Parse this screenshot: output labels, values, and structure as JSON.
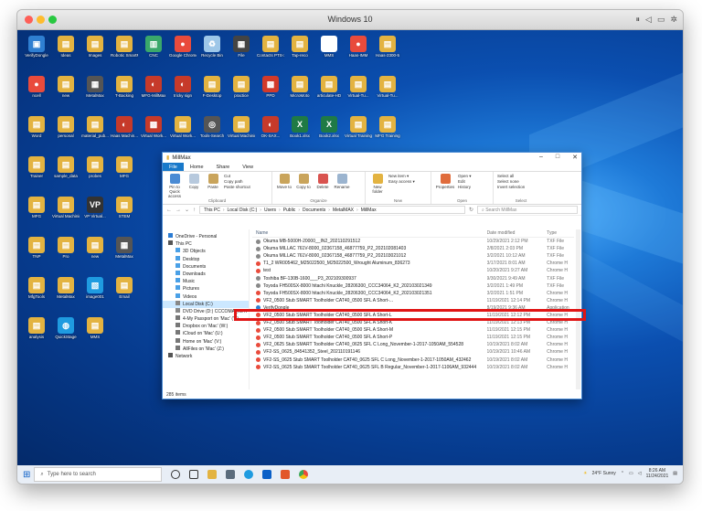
{
  "mac_window": {
    "title": "Windows 10"
  },
  "desktop_icons": [
    {
      "label": "VerifyDongle",
      "color": "#2f7fd1",
      "glyph": "▣"
    },
    {
      "label": "Ideas",
      "color": "#e3b341",
      "glyph": "▤"
    },
    {
      "label": "Images",
      "color": "#e3b341",
      "glyph": "▤"
    },
    {
      "label": "Robotic SmartMachi...",
      "color": "#e3b341",
      "glyph": "▤"
    },
    {
      "label": "CNC",
      "color": "#3aa86b",
      "glyph": "▥"
    },
    {
      "label": "Google Chrome",
      "color": "#e94b3c",
      "glyph": "●"
    },
    {
      "label": "Recycle Bin",
      "color": "#9ec7e8",
      "glyph": "♻"
    },
    {
      "label": "File",
      "color": "#444",
      "glyph": "▦"
    },
    {
      "label": "Contacts PTS-2...",
      "color": "#e3b341",
      "glyph": "▤"
    },
    {
      "label": "Tap-reco",
      "color": "#e3b341",
      "glyph": "▤"
    },
    {
      "label": "MMS",
      "color": "#fff",
      "glyph": "▢"
    },
    {
      "label": "Haas-IMM",
      "color": "#e94b3c",
      "glyph": "●"
    },
    {
      "label": "Haas-2300-5",
      "color": "#e3b341",
      "glyph": "▤"
    },
    {
      "label": "ncell",
      "color": "#e94b3c",
      "glyph": "●"
    },
    {
      "label": "new",
      "color": "#e3b341",
      "glyph": "▤"
    },
    {
      "label": "MetalMax",
      "color": "#555",
      "glyph": "▦"
    },
    {
      "label": "T-Backing",
      "color": "#e3b341",
      "glyph": "▤"
    },
    {
      "label": "MFG-MillMax",
      "color": "#c63a2a",
      "glyph": "◐"
    },
    {
      "label": "tricky sign",
      "color": "#c63a2a",
      "glyph": "◐"
    },
    {
      "label": "F-Desktop",
      "color": "#e3b341",
      "glyph": "▤"
    },
    {
      "label": "practice",
      "color": "#e3b341",
      "glyph": "▤"
    },
    {
      "label": "PPD",
      "color": "#d23a2a",
      "glyph": "▩"
    },
    {
      "label": "MicroMoto",
      "color": "#e3b341",
      "glyph": "▤"
    },
    {
      "label": "articulate-HD",
      "color": "#e3b341",
      "glyph": "▤"
    },
    {
      "label": "Virtual-Tu...",
      "color": "#e3b341",
      "glyph": "▤"
    },
    {
      "label": "Virtual-Tu...",
      "color": "#e3b341",
      "glyph": "▤"
    },
    {
      "label": "Word",
      "color": "#e3b341",
      "glyph": "▤"
    },
    {
      "label": "personal",
      "color": "#e3b341",
      "glyph": "▤"
    },
    {
      "label": "material_pub...",
      "color": "#e3b341",
      "glyph": "▤"
    },
    {
      "label": "Haas Machin...",
      "color": "#c63a2a",
      "glyph": "◐"
    },
    {
      "label": "Virtual Work...",
      "color": "#c63a2a",
      "glyph": "▩"
    },
    {
      "label": "Virtual Work...",
      "color": "#e3b341",
      "glyph": "▤"
    },
    {
      "label": "Tools-Search",
      "color": "#555",
      "glyph": "◎"
    },
    {
      "label": "Virtual Machining",
      "color": "#e3b341",
      "glyph": "▤"
    },
    {
      "label": "OK-SAX...",
      "color": "#c63a2a",
      "glyph": "◐"
    },
    {
      "label": "Book1.xlsx",
      "color": "#1f7a45",
      "glyph": "X"
    },
    {
      "label": "Book2.xlsx",
      "color": "#1f7a45",
      "glyph": "X"
    },
    {
      "label": "Virtual Training",
      "color": "#e3b341",
      "glyph": "▤"
    },
    {
      "label": "MFG Training",
      "color": "#e3b341",
      "glyph": "▤"
    },
    {
      "label": "Trainer",
      "color": "#e3b341",
      "glyph": "▤"
    },
    {
      "label": "sample_data",
      "color": "#e3b341",
      "glyph": "▤"
    },
    {
      "label": "probes",
      "color": "#e3b341",
      "glyph": "▤"
    },
    {
      "label": "MFG",
      "color": "#e3b341",
      "glyph": "▤"
    },
    {
      "label": "MFG",
      "color": "#e3b341",
      "glyph": "▤"
    },
    {
      "label": "Virtual Machining",
      "color": "#e3b341",
      "glyph": "▤"
    },
    {
      "label": "VP Virtual...",
      "color": "#333",
      "glyph": "VP"
    },
    {
      "label": "STEM",
      "color": "#e3b341",
      "glyph": "▤"
    },
    {
      "label": "TNP",
      "color": "#e3b341",
      "glyph": "▤"
    },
    {
      "label": "Pro",
      "color": "#e3b341",
      "glyph": "▤"
    },
    {
      "label": "new",
      "color": "#e3b341",
      "glyph": "▤"
    },
    {
      "label": "MetalMax",
      "color": "#555",
      "glyph": "▦"
    },
    {
      "label": "MfgTools",
      "color": "#e3b341",
      "glyph": "▤"
    },
    {
      "label": "MetalMax",
      "color": "#e3b341",
      "glyph": "▤"
    },
    {
      "label": "image001",
      "color": "#1f9be0",
      "glyph": "▧"
    },
    {
      "label": "Email",
      "color": "#e3b341",
      "glyph": "▤"
    },
    {
      "label": "analysis",
      "color": "#e3b341",
      "glyph": "▤"
    },
    {
      "label": "QuickStage",
      "color": "#1f9be0",
      "glyph": "◍"
    },
    {
      "label": "MMS",
      "color": "#e3b341",
      "glyph": "▤"
    }
  ],
  "explorer": {
    "title": "MillMax",
    "ribbon_tabs": [
      "File",
      "Home",
      "Share",
      "View"
    ],
    "ribbon": {
      "clipboard": {
        "pin": "Pin to Quick access",
        "copy": "Copy",
        "paste": "Paste",
        "cut": "Cut",
        "copy_path": "Copy path",
        "paste_shortcut": "Paste shortcut",
        "label": "Clipboard"
      },
      "organize": {
        "move": "Move to",
        "copy": "Copy to",
        "delete": "Delete",
        "rename": "Rename",
        "label": "Organize"
      },
      "new": {
        "folder": "New folder",
        "new_item": "New item ▾",
        "easy_access": "Easy access ▾",
        "label": "New"
      },
      "open": {
        "properties": "Properties",
        "open": "Open ▾",
        "edit": "Edit",
        "history": "History",
        "label": "Open"
      },
      "select": {
        "all": "Select all",
        "none": "Select none",
        "invert": "Invert selection",
        "label": "Select"
      }
    },
    "address": {
      "path": [
        "This PC",
        "Local Disk (C:)",
        "Users",
        "Public",
        "Documents",
        "MetalMAX",
        "MillMax"
      ],
      "search_placeholder": "Search MillMax"
    },
    "nav": [
      {
        "label": "OneDrive - Personal",
        "top": true,
        "color": "#2b7cd3"
      },
      {
        "label": "This PC",
        "top": true,
        "color": "#555"
      },
      {
        "label": "3D Objects",
        "color": "#4aa0e6"
      },
      {
        "label": "Desktop",
        "color": "#4aa0e6"
      },
      {
        "label": "Documents",
        "color": "#4aa0e6"
      },
      {
        "label": "Downloads",
        "color": "#4aa0e6"
      },
      {
        "label": "Music",
        "color": "#4aa0e6"
      },
      {
        "label": "Pictures",
        "color": "#4aa0e6"
      },
      {
        "label": "Videos",
        "color": "#4aa0e6"
      },
      {
        "label": "Local Disk (C:)",
        "color": "#888",
        "selected": true
      },
      {
        "label": "DVD Drive (D:) CCCOMA_X64FR",
        "color": "#888"
      },
      {
        "label": "4-My Passport on 'Mac' (Y:)",
        "color": "#777"
      },
      {
        "label": "Dropbox on 'Mac' (W:)",
        "color": "#777"
      },
      {
        "label": "iCloud on 'Mac' (U:)",
        "color": "#777"
      },
      {
        "label": "Home on 'Mac' (V:)",
        "color": "#777"
      },
      {
        "label": "AllFiles on 'Mac' (Z:)",
        "color": "#777"
      },
      {
        "label": "Network",
        "top": true,
        "color": "#555"
      }
    ],
    "columns": {
      "name": "Name",
      "date": "Date modified",
      "type": "Type"
    },
    "files": [
      {
        "name": "Okuma MB-5000H-20000__IN2_202110291512",
        "date": "10/29/2021 2:12 PM",
        "type": "TXF File",
        "color": "#888"
      },
      {
        "name": "Okuma MILLAC 761V-8000_02367158_46877759_P2_202102081403",
        "date": "2/8/2021 2:03 PM",
        "type": "TXF File",
        "color": "#888"
      },
      {
        "name": "Okuma MILLAC 761V-8000_02367158_46877759_P2_202103021012",
        "date": "3/2/2021 10:12 AM",
        "type": "TXF File",
        "color": "#888"
      },
      {
        "name": "T1_2 WR005462_M25022500_M25022500_Wrought Aluminum_836273",
        "date": "3/17/2021 8:01 AM",
        "type": "Chrome H",
        "color": "#e94b3c"
      },
      {
        "name": "test",
        "date": "10/20/2021 9:27 AM",
        "type": "Chrome H",
        "color": "#e94b3c"
      },
      {
        "name": "Toshiba BF-130B-1600___P3_202109300937",
        "date": "9/30/2021 9:49 AM",
        "type": "TXF File",
        "color": "#888"
      },
      {
        "name": "Toyoda FH500SX-8000 hitachi Knuckle_28206300_CCC34064_K2_202103021349",
        "date": "3/2/2021 1:49 PM",
        "type": "TXF File",
        "color": "#888"
      },
      {
        "name": "Toyoda FH500SX-8000 hitachi Knuckle_28206300_CCC34064_K2_202103021351",
        "date": "3/2/2021 1:51 PM",
        "type": "Chrome H",
        "color": "#e94b3c"
      },
      {
        "name": "VF2_0500 Stub SMART Toolholder CAT40_0500 SFL A Short-...",
        "date": "11/19/2021 12:14 PM",
        "type": "Chrome H",
        "color": "#e94b3c"
      },
      {
        "name": "VerifyDongle",
        "date": "8/19/2021 9:36 AM",
        "type": "Application",
        "color": "#2f7fd1"
      },
      {
        "name": "VF2_0500 Stub SMART Toolholder CAT40_0500 SFL A Short-L",
        "date": "11/19/2021 12:12 PM",
        "type": "Chrome H",
        "color": "#e94b3c"
      },
      {
        "name": "VF2_0500 Stub SMART Toolholder CAT40_0500 SFL A Short-K",
        "date": "11/19/2021 12:13 PM",
        "type": "Chrome H",
        "color": "#e94b3c"
      },
      {
        "name": "VF2_0500 Stub SMART Toolholder CAT40_0500 SFL A Short-M",
        "date": "11/19/2021 12:15 PM",
        "type": "Chrome H",
        "color": "#e94b3c"
      },
      {
        "name": "VF2_0500 Stub SMART Toolholder CAT40_0500 SFL A Short-P",
        "date": "11/19/2021 12:15 PM",
        "type": "Chrome H",
        "color": "#e94b3c"
      },
      {
        "name": "VF2_0625 Stub SMART Toolholder CAT40_0625 SFL C Long_November-1-2017-1050AM_554528",
        "date": "10/19/2021 8:02 AM",
        "type": "Chrome H",
        "color": "#e94b3c"
      },
      {
        "name": "VF2-SS_0625_84541352_Steel_202110191146",
        "date": "10/19/2021 10:46 AM",
        "type": "Chrome H",
        "color": "#e94b3c"
      },
      {
        "name": "VF2-SS_0625 Stub SMART Toolholder CAT40_0625 SFL C Long_November-1-2017-1050AM_432462",
        "date": "10/19/2021 8:02 AM",
        "type": "Chrome H",
        "color": "#e94b3c"
      },
      {
        "name": "VF2-SS_0625 Stub SMART Toolholder CAT40_0625 SFL B Regular_November-1-2017-1106AM_932444",
        "date": "10/19/2021 8:02 AM",
        "type": "Chrome H",
        "color": "#e94b3c"
      }
    ],
    "status": "285 items"
  },
  "taskbar": {
    "search_placeholder": "Type here to search",
    "weather": "24°F  Sunny",
    "time": "8:26 AM",
    "date": "11/24/2021"
  }
}
